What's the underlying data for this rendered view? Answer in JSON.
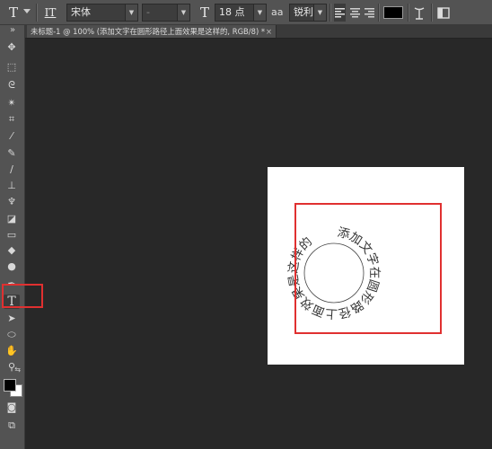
{
  "options_bar": {
    "tool_glyph": "T",
    "orient_glyph": "IT",
    "font_family": "宋体",
    "font_style": "-",
    "size_glyph": "T",
    "font_size": "18 点",
    "aa_label": "aa",
    "antialias": "锐利",
    "text_color": "#000000",
    "icons": [
      "type-tool-icon",
      "chevron-down-icon",
      "text-orientation-icon",
      "font-size-icon",
      "align-left-icon",
      "align-center-icon",
      "align-right-icon",
      "warp-text-icon",
      "panels-icon"
    ]
  },
  "document": {
    "tab_title": "未标题-1 @ 100% (添加文字在圆形路径上面效果是这样的, RGB/8) *",
    "close": "×"
  },
  "canvas": {
    "path_text": "添加文字在圆形路径上面效果是这样的",
    "annotation_color": "#e03030"
  },
  "toolbox": {
    "collapse_glyph": "»",
    "tools": [
      {
        "name": "move-tool-icon",
        "glyph": "✥"
      },
      {
        "name": "marquee-tool-icon",
        "glyph": "⬚"
      },
      {
        "name": "lasso-tool-icon",
        "glyph": "ᘓ"
      },
      {
        "name": "magic-wand-tool-icon",
        "glyph": "✴"
      },
      {
        "name": "crop-tool-icon",
        "glyph": "⌗"
      },
      {
        "name": "eyedropper-tool-icon",
        "glyph": "⁄"
      },
      {
        "name": "healing-brush-tool-icon",
        "glyph": "✎"
      },
      {
        "name": "brush-tool-icon",
        "glyph": "∕"
      },
      {
        "name": "clone-stamp-tool-icon",
        "glyph": "⊥"
      },
      {
        "name": "history-brush-tool-icon",
        "glyph": "♆"
      },
      {
        "name": "eraser-tool-icon",
        "glyph": "◪"
      },
      {
        "name": "gradient-tool-icon",
        "glyph": "▭"
      },
      {
        "name": "blur-tool-icon",
        "glyph": "◆"
      },
      {
        "name": "dodge-tool-icon",
        "glyph": "●"
      },
      {
        "name": "pen-tool-icon",
        "glyph": "✒"
      },
      {
        "name": "type-tool-icon",
        "glyph": "T"
      },
      {
        "name": "path-selection-tool-icon",
        "glyph": "➤"
      },
      {
        "name": "ellipse-tool-icon",
        "glyph": "⬭"
      },
      {
        "name": "hand-tool-icon",
        "glyph": "✋"
      },
      {
        "name": "zoom-tool-icon",
        "glyph": "⚲"
      }
    ],
    "swap_glyph": "⇆",
    "foreground": "#000000",
    "background": "#ffffff",
    "quick_mask_glyph": "◙",
    "screen_mode_glyph": "⧉"
  }
}
